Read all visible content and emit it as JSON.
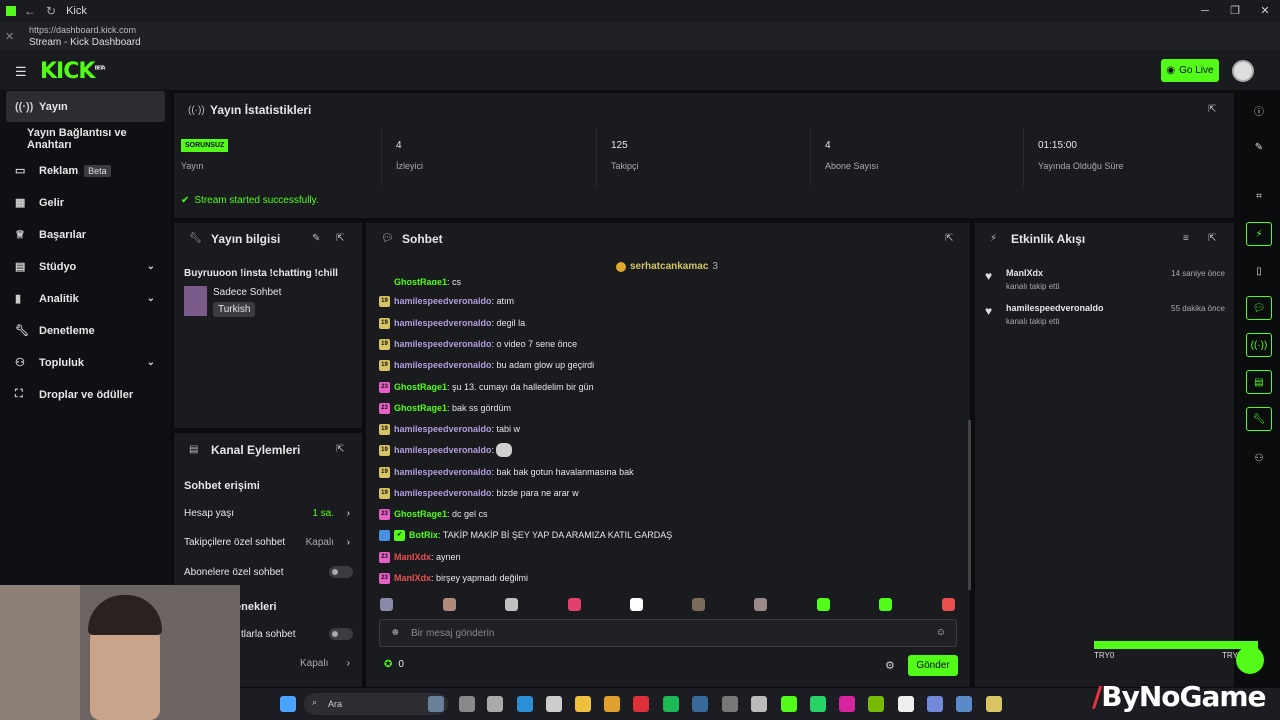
{
  "browser": {
    "tab_title": "Kick",
    "url": "https://dashboard.kick.com",
    "page_title": "Stream - Kick Dashboard"
  },
  "header": {
    "logo": "KICK",
    "logo_sup": "BETA",
    "go_live": "Go Live"
  },
  "sidebar": {
    "items": [
      {
        "label": "Yayın",
        "icon": "broadcast-icon"
      },
      {
        "label": "Yayın Bağlantısı ve Anahtarı"
      },
      {
        "label": "Reklam",
        "icon": "monitor-icon",
        "badge": "Beta"
      },
      {
        "label": "Gelir",
        "icon": "money-icon"
      },
      {
        "label": "Başarılar",
        "icon": "trophy-icon"
      },
      {
        "label": "Stüdyo",
        "icon": "studio-icon"
      },
      {
        "label": "Analitik",
        "icon": "chart-icon"
      },
      {
        "label": "Denetleme",
        "icon": "wrench-icon"
      },
      {
        "label": "Topluluk",
        "icon": "community-icon"
      },
      {
        "label": "Droplar ve ödüller",
        "icon": "drops-icon"
      }
    ]
  },
  "stats": {
    "title": "Yayın İstatistikleri",
    "status_badge": "SORUNSUZ",
    "status_label": "Yayın",
    "cells": [
      {
        "value": "4",
        "label": "İzleyici"
      },
      {
        "value": "125",
        "label": "Takipçi"
      },
      {
        "value": "4",
        "label": "Abone Sayısı"
      },
      {
        "value": "01:15:00",
        "label": "Yayında Olduğu Süre"
      }
    ],
    "success_msg": "Stream started successfully."
  },
  "stream_info": {
    "title": "Yayın bilgisi",
    "stream_title": "Buyruuoon !insta !chatting !chill",
    "category": "Sadece Sohbet",
    "tag": "Turkish"
  },
  "channel_actions": {
    "title": "Kanal Eylemleri",
    "section": "Sohbet erişimi",
    "rows": [
      {
        "label": "Hesap yaşı",
        "value": "1 sa."
      },
      {
        "label": "Takipçilere özel sohbet",
        "value": "Kapalı"
      },
      {
        "label": "Abonelere özel sohbet"
      }
    ],
    "section2": "enekleri",
    "row4": "tlarla sohbet",
    "row5_value": "Kapalı"
  },
  "chat": {
    "title": "Sohbet",
    "pinned_user": "serhatcankamac",
    "pinned_count": "3",
    "messages": [
      {
        "badge": "19",
        "user": "hamilespeedveronaldo",
        "text": ": atım",
        "color": "#b39ddb",
        "badge_color": "#d8c463"
      },
      {
        "badge": "19",
        "user": "hamilespeedveronaldo",
        "text": ": degil la",
        "color": "#b39ddb",
        "badge_color": "#d8c463"
      },
      {
        "badge": "19",
        "user": "hamilespeedveronaldo",
        "text": ": o video 7 sene önce",
        "color": "#b39ddb",
        "badge_color": "#d8c463"
      },
      {
        "badge": "19",
        "user": "hamilespeedveronaldo",
        "text": ": bu adam glow up geçirdi",
        "color": "#b39ddb",
        "badge_color": "#d8c463"
      },
      {
        "badge": "23",
        "user": "GhostRage1",
        "text": ": şu 13. cumayı da halledelim bir gün",
        "color": "#53fc18",
        "badge_color": "#e85fc8"
      },
      {
        "badge": "23",
        "user": "GhostRage1",
        "text": ": bak ss gördüm",
        "color": "#53fc18",
        "badge_color": "#e85fc8"
      },
      {
        "badge": "19",
        "user": "hamilespeedveronaldo",
        "text": ": tabi w",
        "color": "#b39ddb",
        "badge_color": "#d8c463"
      },
      {
        "badge": "19",
        "user": "hamilespeedveronaldo",
        "text": ": ",
        "color": "#b39ddb",
        "badge_color": "#d8c463"
      },
      {
        "badge": "19",
        "user": "hamilespeedveronaldo",
        "text": ": bak bak gotun havalanmasına bak",
        "color": "#b39ddb",
        "badge_color": "#d8c463"
      },
      {
        "badge": "19",
        "user": "hamilespeedveronaldo",
        "text": ": bizde para ne arar w",
        "color": "#b39ddb",
        "badge_color": "#d8c463"
      },
      {
        "badge": "23",
        "user": "GhostRage1",
        "text": ": dc gel cs",
        "color": "#53fc18",
        "badge_color": "#e85fc8"
      },
      {
        "badge": "",
        "user": "BotRix",
        "text": ": TAKİP MAKİP Bİ ŞEY YAP DA ARAMIZA KATIL GARDAŞ",
        "color": "#53fc18",
        "badge_color": "#4a90e2"
      },
      {
        "badge": "23",
        "user": "ManIXdx",
        "text": ": aynen",
        "color": "#e85050",
        "badge_color": "#e85fc8"
      },
      {
        "badge": "23",
        "user": "ManIXdx",
        "text": ": birşey yapmadı değilmi",
        "color": "#e85050",
        "badge_color": "#e85fc8"
      }
    ],
    "partial_top": {
      "badge": "23",
      "user": "GhostRage1",
      "text": ": cs"
    },
    "input_placeholder": "Bir mesaj gönderin",
    "points": "0",
    "send": "Gönder"
  },
  "activity": {
    "title": "Etkinlik Akışı",
    "events": [
      {
        "user": "ManIXdx",
        "action": "kanalı takip etti",
        "time": "14 saniye önce"
      },
      {
        "user": "hamilespeedveronaldo",
        "action": "kanalı takip etti",
        "time": "55 dakika önce"
      }
    ]
  },
  "overlay": {
    "left": "TRY0",
    "right": "TRY",
    "brand": "ByNoGame"
  },
  "taskbar": {
    "search": "Ara"
  }
}
